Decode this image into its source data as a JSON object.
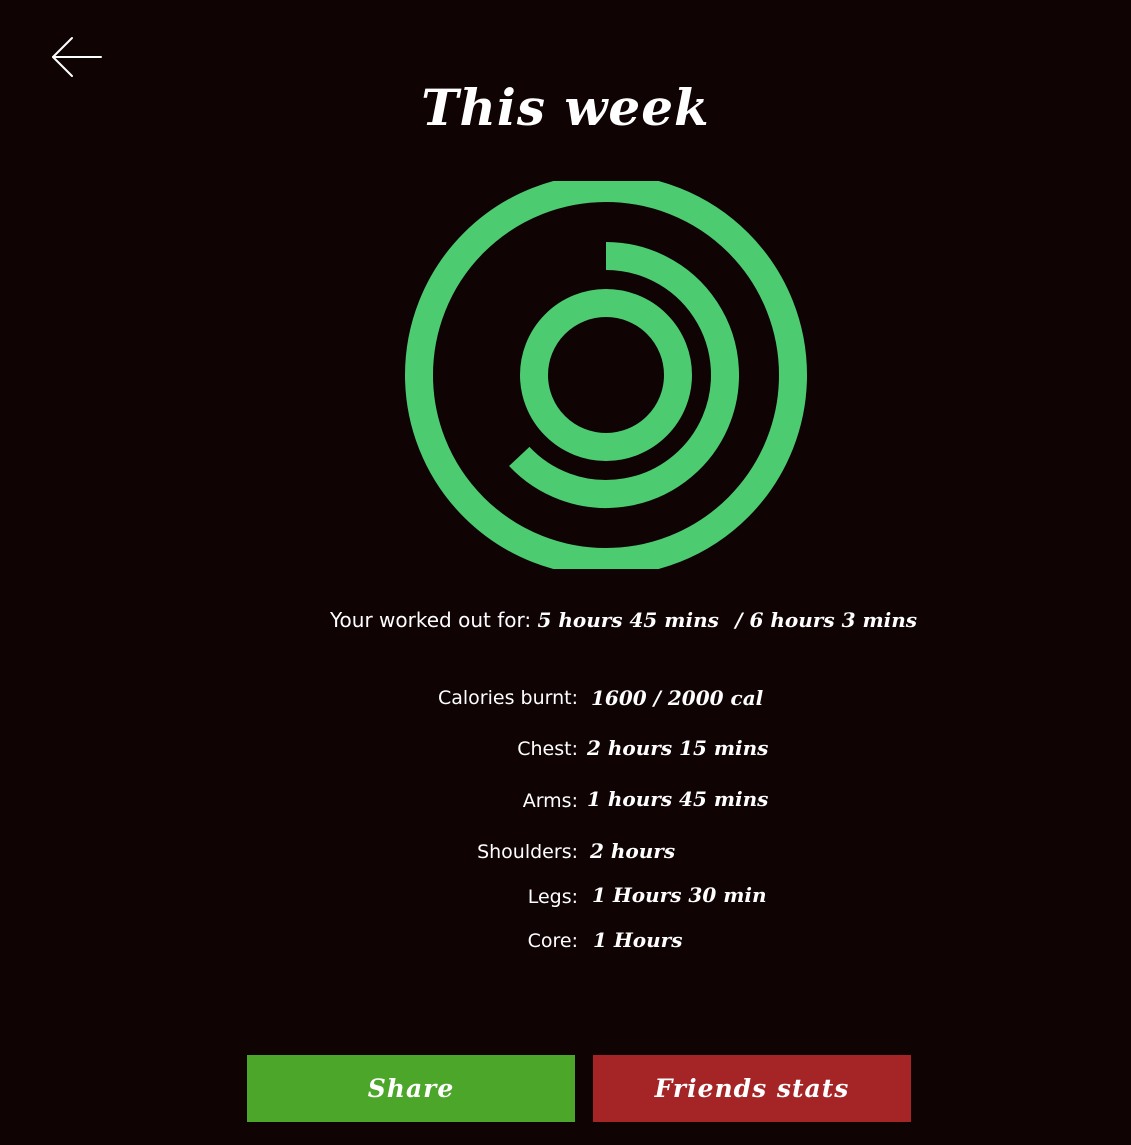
{
  "colors": {
    "background": "#100304",
    "ring": "#4ccb71",
    "share_button": "#4ca62a",
    "friends_button": "#a52527",
    "text": "#ffffff"
  },
  "header": {
    "back_icon": "arrow-left-icon",
    "title": "This week"
  },
  "progress": {
    "outer_ring_fraction": 1.0,
    "middle_ring_fraction": 0.63,
    "inner_ring_fraction": 1.0
  },
  "summary": {
    "worked_label": "Your worked out for:",
    "worked_value": "5 hours 45 mins",
    "worked_goal": "/ 6 hours 3 mins"
  },
  "stats": [
    {
      "label": "Calories burnt:",
      "value": "1600 / 2000 cal"
    },
    {
      "label": "Chest:",
      "value": "2 hours 15 mins"
    },
    {
      "label": "Arms:",
      "value": "1 hours 45 mins"
    },
    {
      "label": "Shoulders:",
      "value": "2 hours"
    },
    {
      "label": "Legs:",
      "value": "1 Hours 30 min"
    },
    {
      "label": "Core:",
      "value": "1 Hours"
    }
  ],
  "actions": {
    "share_label": "Share",
    "friends_label": "Friends stats"
  }
}
